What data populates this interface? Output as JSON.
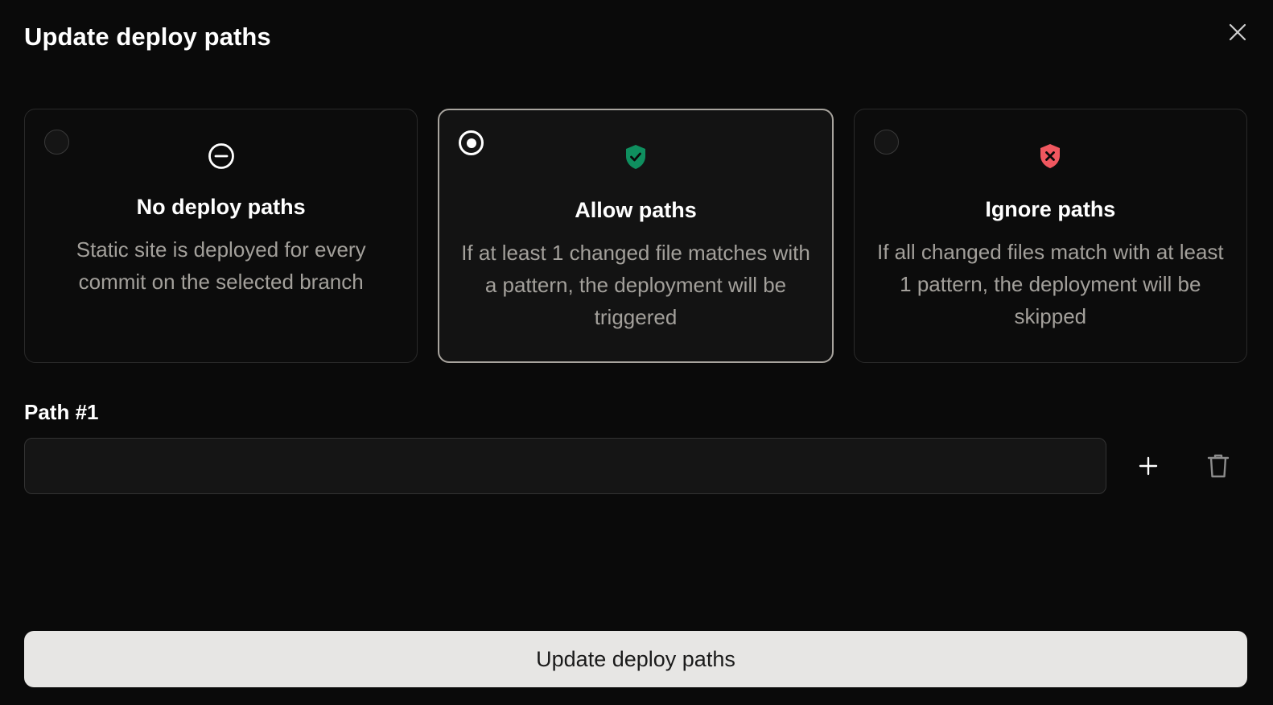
{
  "dialog": {
    "title": "Update deploy paths",
    "close_icon": "close-icon"
  },
  "options": [
    {
      "id": "none",
      "title": "No deploy paths",
      "description": "Static site is deployed for every commit on the selected branch",
      "icon": "minus-circle-icon",
      "selected": false
    },
    {
      "id": "allow",
      "title": "Allow paths",
      "description": "If at least 1 changed file matches with a pattern, the deployment will be triggered",
      "icon": "shield-check-icon",
      "icon_color": "#0f8f5f",
      "selected": true
    },
    {
      "id": "ignore",
      "title": "Ignore paths",
      "description": "If all changed files match with at least 1 pattern, the deployment will be skipped",
      "icon": "shield-x-icon",
      "icon_color": "#f0575f",
      "selected": false
    }
  ],
  "paths": [
    {
      "label": "Path #1",
      "value": "",
      "placeholder": ""
    }
  ],
  "actions": {
    "add_icon": "plus-icon",
    "delete_icon": "trash-icon",
    "submit_label": "Update deploy paths"
  },
  "colors": {
    "background": "#0a0a0a",
    "card_border": "#2a2a2a",
    "selected_border": "#a8a49e",
    "muted_text": "#a3a09b",
    "button_bg": "#e7e6e4"
  }
}
